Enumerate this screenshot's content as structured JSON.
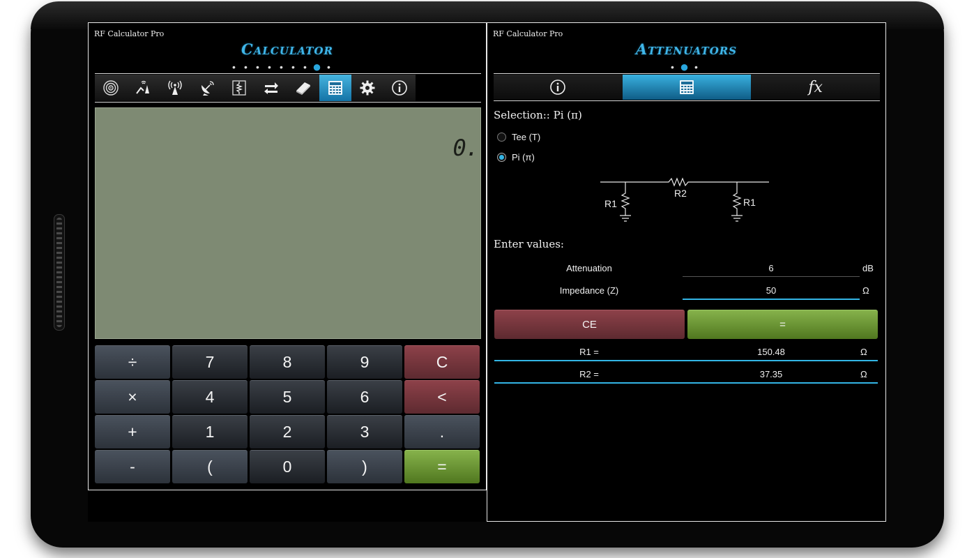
{
  "left_panel": {
    "app_title": "RF Calculator Pro",
    "page_title": "Calculator",
    "page_dots": {
      "count": 9,
      "active_index": 7
    },
    "toolbar": [
      {
        "icon": "antenna-signal-icon"
      },
      {
        "icon": "link-budget-icon"
      },
      {
        "icon": "broadcast-tower-icon"
      },
      {
        "icon": "satellite-dish-icon"
      },
      {
        "icon": "resistor-icon"
      },
      {
        "icon": "convert-arrows-icon"
      },
      {
        "icon": "book-icon"
      },
      {
        "icon": "calculator-icon",
        "active": true
      },
      {
        "icon": "gear-icon"
      },
      {
        "icon": "info-icon"
      }
    ],
    "display_value": "0.",
    "keys": [
      [
        "÷",
        "7",
        "8",
        "9",
        "C"
      ],
      [
        "×",
        "4",
        "5",
        "6",
        "<"
      ],
      [
        "+",
        "1",
        "2",
        "3",
        "."
      ],
      [
        "-",
        "(",
        "0",
        ")",
        "="
      ]
    ]
  },
  "right_panel": {
    "app_title": "RF Calculator Pro",
    "page_title": "Attenuators",
    "page_dots": {
      "count": 3,
      "active_index": 1
    },
    "tabs": [
      {
        "icon": "info-icon"
      },
      {
        "icon": "calculator-icon",
        "active": true
      },
      {
        "icon": "fx-icon",
        "label": "fx"
      }
    ],
    "selection_label": "Selection:: Pi (π)",
    "options": [
      {
        "label": "Tee (T)",
        "checked": false
      },
      {
        "label": "Pi (π)",
        "checked": true
      }
    ],
    "schematic": {
      "r1_left": "R1",
      "r2": "R2",
      "r1_right": "R1"
    },
    "enter_values_label": "Enter values:",
    "inputs": [
      {
        "label": "Attenuation",
        "value": "6",
        "unit": "dB"
      },
      {
        "label": "Impedance (Z)",
        "value": "50",
        "unit": "Ω"
      }
    ],
    "ce_label": "CE",
    "equals_label": "=",
    "results": [
      {
        "label": "R1 =",
        "value": "150.48",
        "unit": "Ω"
      },
      {
        "label": "R2 =",
        "value": "37.35",
        "unit": "Ω"
      }
    ]
  },
  "colors": {
    "accent": "#33b5e5",
    "lcd": "#7e8a73",
    "red_key": "#8d4149",
    "green_key": "#86b24b"
  }
}
